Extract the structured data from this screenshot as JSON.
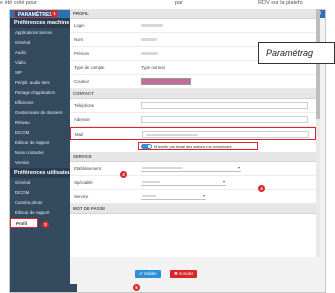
{
  "top_strip": {
    "left_text": "e été créé pour",
    "mid_text": "par",
    "right_text": "RDV sur la platefo"
  },
  "window": {
    "tab_label": "PARAMÈTRES"
  },
  "sidebar": {
    "section1_title": "Préférences machine",
    "section1_items": [
      {
        "label": "Applications tierces"
      },
      {
        "label": "Général"
      },
      {
        "label": "Audio"
      },
      {
        "label": "Vidéo"
      },
      {
        "label": "SIP"
      },
      {
        "label": "Périph. audio tiers"
      },
      {
        "label": "Partage d'application"
      },
      {
        "label": "Efficience"
      },
      {
        "label": "Gestionnaire de dossiers"
      },
      {
        "label": "Réseau"
      },
      {
        "label": "DICOM"
      },
      {
        "label": "Éditeur de rapport"
      },
      {
        "label": "Nous contacter"
      },
      {
        "label": "Version"
      }
    ],
    "section2_title": "Préférences utilisateur",
    "section2_items": [
      {
        "label": "Général"
      },
      {
        "label": "DICOM"
      },
      {
        "label": "Caméra photo"
      },
      {
        "label": "Éditeur de rapport"
      },
      {
        "label": "Profil"
      }
    ]
  },
  "profile": {
    "header": "PROFIL",
    "login_label": "Login",
    "nom_label": "Nom",
    "prenom_label": "Prénom",
    "type_label": "Type de compte",
    "type_value": "Type normal",
    "couleur_label": "Couleur",
    "couleur_value": "#c06b98"
  },
  "contact": {
    "header": "CONTACT",
    "telephone_label": "Téléphone",
    "adresse_label": "Adresse",
    "mail_label": "Mail",
    "notify_label": "M'avertir par email des actions me concernant",
    "notify_enabled": true
  },
  "service": {
    "header": "SERVICE",
    "etablissement_label": "Etablissement",
    "specialite_label": "Spécialité",
    "service_label": "Service"
  },
  "password": {
    "header": "MOT DE PASSE"
  },
  "footer": {
    "valider_label": "✔ Valider",
    "annuler_label": "✖ Annuler"
  },
  "markers": [
    "1",
    "2",
    "3",
    "4",
    "5"
  ],
  "tooltip": {
    "text": "Paramétrag"
  },
  "colors": {
    "accent": "#2f6fb4",
    "sidebar_bg": "#344a5e",
    "highlight": "#d9262c",
    "toggle_on": "#2d8fd6"
  }
}
